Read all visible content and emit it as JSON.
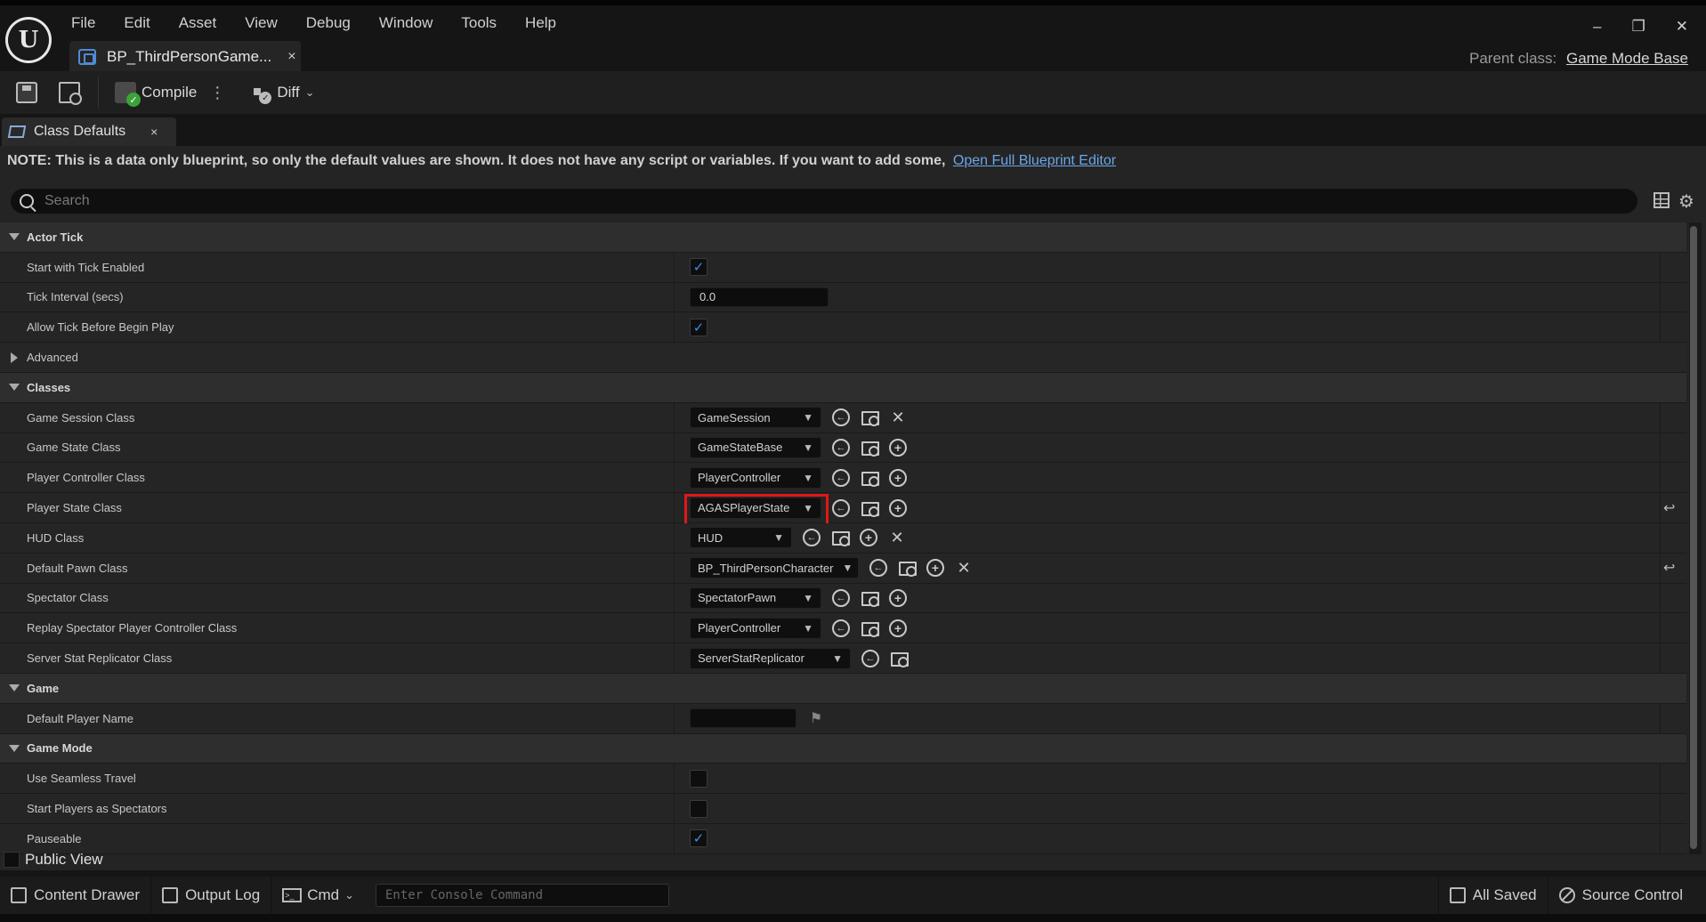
{
  "menu": [
    "File",
    "Edit",
    "Asset",
    "View",
    "Debug",
    "Window",
    "Tools",
    "Help"
  ],
  "document_tab": {
    "label": "BP_ThirdPersonGame...",
    "close": "×"
  },
  "window_controls": {
    "minimize": "–",
    "restore": "❐",
    "close": "✕"
  },
  "parent_class": {
    "label": "Parent class:",
    "value": "Game Mode Base"
  },
  "toolbar": {
    "compile_label": "Compile",
    "diff_label": "Diff"
  },
  "panel_tab": {
    "label": "Class Defaults",
    "close": "×"
  },
  "note": {
    "text": "NOTE: This is a data only blueprint, so only the default values are shown.  It does not have any script or variables.  If you want to add some,",
    "link": "Open Full Blueprint Editor"
  },
  "search": {
    "placeholder": "Search"
  },
  "sections": {
    "actor_tick": "Actor Tick",
    "classes": "Classes",
    "game": "Game",
    "game_mode": "Game Mode"
  },
  "props": {
    "start_with_tick": {
      "label": "Start with Tick Enabled",
      "checked": true
    },
    "tick_interval": {
      "label": "Tick Interval (secs)",
      "value": "0.0"
    },
    "allow_tick": {
      "label": "Allow Tick Before Begin Play",
      "checked": true
    },
    "advanced": {
      "label": "Advanced"
    },
    "game_session": {
      "label": "Game Session Class",
      "value": "GameSession"
    },
    "game_state": {
      "label": "Game State Class",
      "value": "GameStateBase"
    },
    "player_controller": {
      "label": "Player Controller Class",
      "value": "PlayerController"
    },
    "player_state": {
      "label": "Player State Class",
      "value": "AGASPlayerState"
    },
    "hud": {
      "label": "HUD Class",
      "value": "HUD"
    },
    "default_pawn": {
      "label": "Default Pawn Class",
      "value": "BP_ThirdPersonCharacter"
    },
    "spectator": {
      "label": "Spectator Class",
      "value": "SpectatorPawn"
    },
    "replay_spectator": {
      "label": "Replay Spectator Player Controller Class",
      "value": "PlayerController"
    },
    "server_stat": {
      "label": "Server Stat Replicator Class",
      "value": "ServerStatReplicator"
    },
    "default_player_name": {
      "label": "Default Player Name",
      "value": ""
    },
    "seamless_travel": {
      "label": "Use Seamless Travel",
      "checked": false
    },
    "start_spectators": {
      "label": "Start Players as Spectators",
      "checked": false
    },
    "pauseable": {
      "label": "Pauseable",
      "checked": true
    }
  },
  "public_view": "Public View",
  "statusbar": {
    "content_drawer": "Content Drawer",
    "output_log": "Output Log",
    "cmd": "Cmd",
    "console_placeholder": "Enter Console Command",
    "all_saved": "All Saved",
    "source_control": "Source Control"
  },
  "colors": {
    "accent_blue": "#3a8ee6",
    "highlight_red": "#e01818",
    "link_blue": "#6aa6e8"
  }
}
